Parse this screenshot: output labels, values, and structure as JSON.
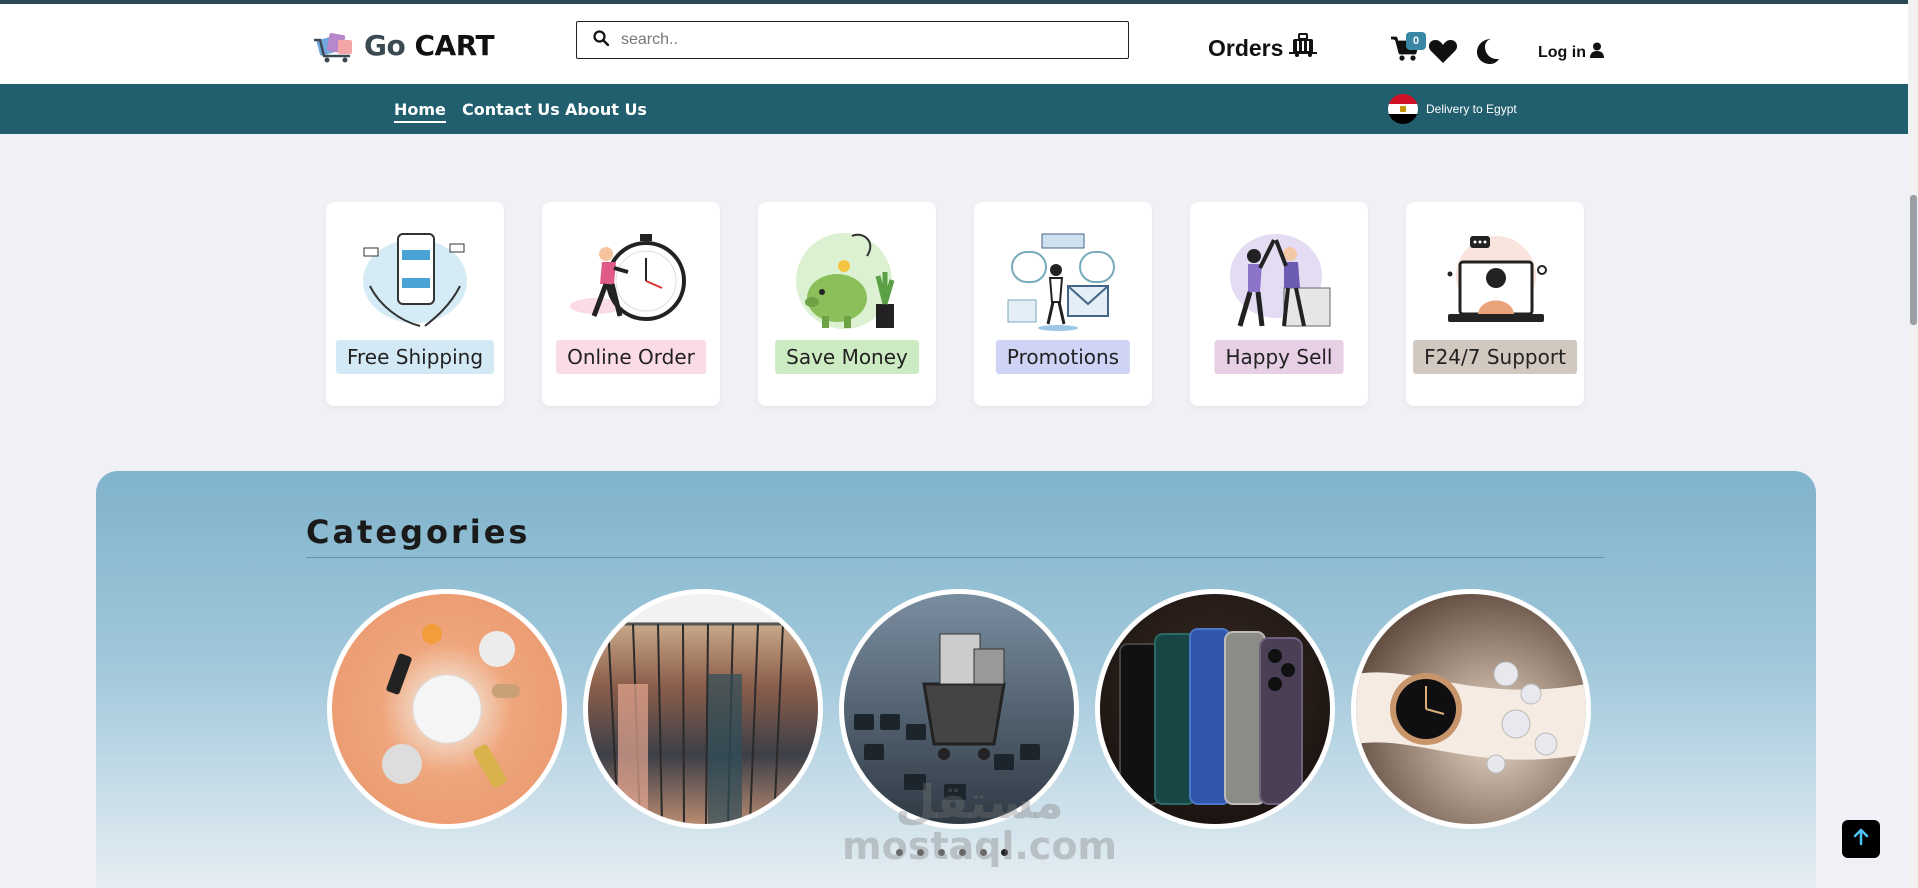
{
  "brand": {
    "prefix": "Go",
    "name": "CART"
  },
  "search": {
    "placeholder": "search.."
  },
  "header": {
    "orders_label": "Orders",
    "cart_count": "0",
    "login_label": "Log in"
  },
  "nav": {
    "items": [
      {
        "label": "Home"
      },
      {
        "label": "Contact Us"
      },
      {
        "label": "About Us"
      }
    ],
    "delivery": "Delivery to Egypt"
  },
  "features": [
    {
      "label": "Free Shipping",
      "color": "#d3e9f5"
    },
    {
      "label": "Online Order",
      "color": "#fbdbe5"
    },
    {
      "label": "Save Money",
      "color": "#cdebc3"
    },
    {
      "label": "Promotions",
      "color": "#cfd3f5"
    },
    {
      "label": "Happy Sell",
      "color": "#e7cfe6"
    },
    {
      "label": "F24/7 Support",
      "color": "#d1c8c0"
    }
  ],
  "categories": {
    "title": "Categories",
    "items": [
      {
        "name": "cosmetics"
      },
      {
        "name": "clothing"
      },
      {
        "name": "electronics"
      },
      {
        "name": "mobiles"
      },
      {
        "name": "accessories"
      }
    ]
  },
  "watermark": {
    "arabic": "مستقل",
    "latin": "mostaql.com"
  },
  "colors": {
    "nav": "#215f6e",
    "badge": "#3a86a6",
    "page": "#eff1f6"
  }
}
